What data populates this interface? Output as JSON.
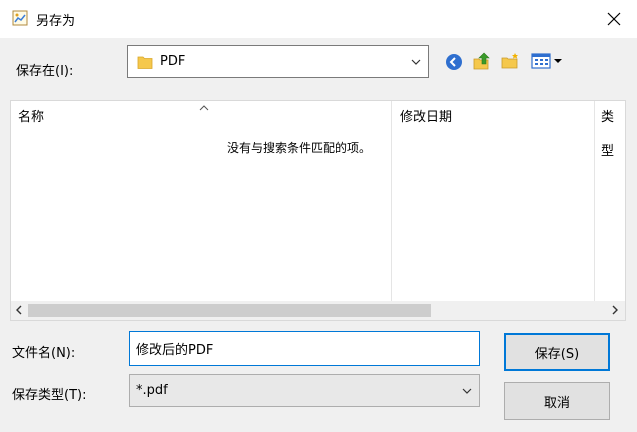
{
  "window": {
    "title": "另存为",
    "icon": "save-as-picture-icon",
    "close_icon": "close-icon"
  },
  "save_in": {
    "label": "保存在(I):",
    "location": "PDF",
    "location_icon": "folder-icon",
    "toolbar_icons": [
      "back-icon",
      "up-folder-icon",
      "new-folder-icon",
      "view-menu-icon"
    ]
  },
  "file_list": {
    "columns": [
      "名称",
      "修改日期",
      "类型"
    ],
    "sorted_column": "名称",
    "empty_message": "没有与搜索条件匹配的项。"
  },
  "file_name": {
    "label": "文件名(N):",
    "value": "修改后的PDF"
  },
  "file_type": {
    "label": "保存类型(T):",
    "value": "*.pdf"
  },
  "buttons": {
    "save": "保存(S)",
    "cancel": "取消"
  },
  "colors": {
    "accent": "#0078d7",
    "background": "#f0f0f0",
    "folder": "#f5c84c"
  }
}
